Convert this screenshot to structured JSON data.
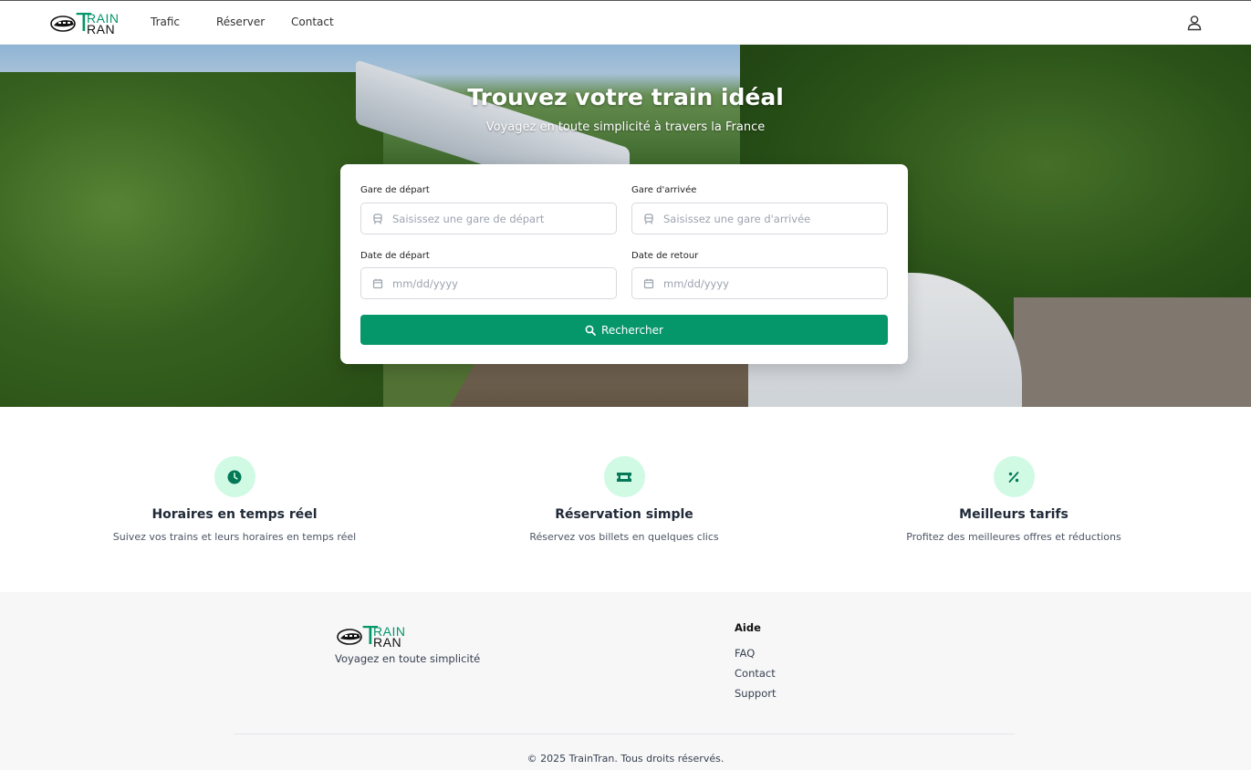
{
  "brand": {
    "word_top": "RAIN",
    "word_bottom": "RAN",
    "initial": "T",
    "accent": "#059669"
  },
  "nav": {
    "items": [
      "Trafic",
      "Réserver",
      "Contact"
    ],
    "user_icon": "user-icon"
  },
  "hero": {
    "title": "Trouvez votre train idéal",
    "subtitle": "Voyagez en toute simplicité à travers la France"
  },
  "search": {
    "departure_label": "Gare de départ",
    "departure_placeholder": "Saisissez une gare de départ",
    "arrival_label": "Gare d'arrivée",
    "arrival_placeholder": "Saisissez une gare d'arrivée",
    "depart_date_label": "Date de départ",
    "return_date_label": "Date de retour",
    "date_placeholder": "mm/dd/yyyy",
    "submit_label": "Rechercher",
    "station_icon": "train-icon",
    "date_icon": "calendar-icon",
    "submit_icon": "search-icon"
  },
  "features": [
    {
      "icon": "clock-icon",
      "title": "Horaires en temps réel",
      "desc": "Suivez vos trains et leurs horaires en temps réel"
    },
    {
      "icon": "ticket-icon",
      "title": "Réservation simple",
      "desc": "Réservez vos billets en quelques clics"
    },
    {
      "icon": "percent-icon",
      "title": "Meilleurs tarifs",
      "desc": "Profitez des meilleures offres et réductions"
    }
  ],
  "footer": {
    "tagline": "Voyagez en toute simplicité",
    "help_heading": "Aide",
    "help_links": [
      "FAQ",
      "Contact",
      "Support"
    ],
    "copyright": "© 2025 TrainTran. Tous droits réservés."
  }
}
